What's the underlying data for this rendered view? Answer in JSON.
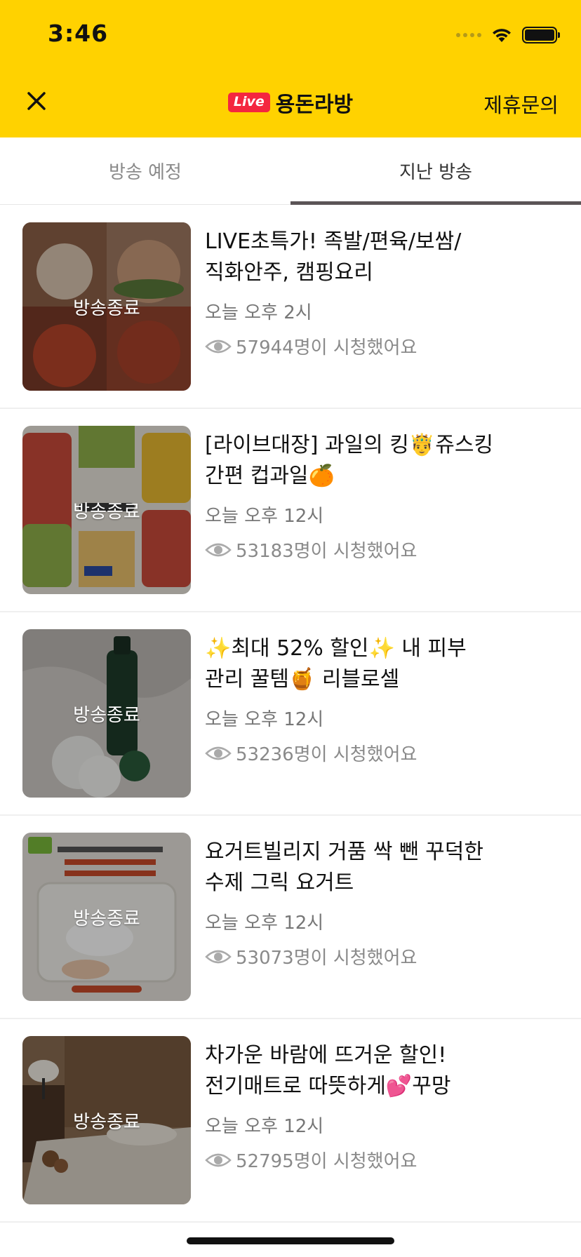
{
  "status_bar": {
    "time": "3:46"
  },
  "header": {
    "live_badge": "Live",
    "channel_name": "용돈라방",
    "partner_label": "제휴문의"
  },
  "tabs": [
    {
      "label": "방송 예정",
      "active": false
    },
    {
      "label": "지난 방송",
      "active": true
    }
  ],
  "items": [
    {
      "title": "LIVE초특가! 족발/편육/보쌈/직화안주, 캠핑요리",
      "time": "오늘 오후 2시",
      "views": "57944명이 시청했어요",
      "overlay": "방송종료"
    },
    {
      "title": "[라이브대장] 과일의 킹🤴쥬스킹 간편 컵과일🍊",
      "time": "오늘 오후 12시",
      "views": "53183명이 시청했어요",
      "overlay": "방송종료"
    },
    {
      "title": "✨최대 52% 할인✨ 내 피부 관리 꿀템🍯 리블로셀",
      "time": "오늘 오후 12시",
      "views": "53236명이 시청했어요",
      "overlay": "방송종료"
    },
    {
      "title": "요거트빌리지 거품 싹 뺀 꾸덕한 수제 그릭 요거트",
      "time": "오늘 오후 12시",
      "views": "53073명이 시청했어요",
      "overlay": "방송종료"
    },
    {
      "title": "차가운 바람에 뜨거운 할인! 전기매트로 따뜻하게💕꾸망",
      "time": "오늘 오후 12시",
      "views": "52795명이 시청했어요",
      "overlay": "방송종료"
    }
  ]
}
